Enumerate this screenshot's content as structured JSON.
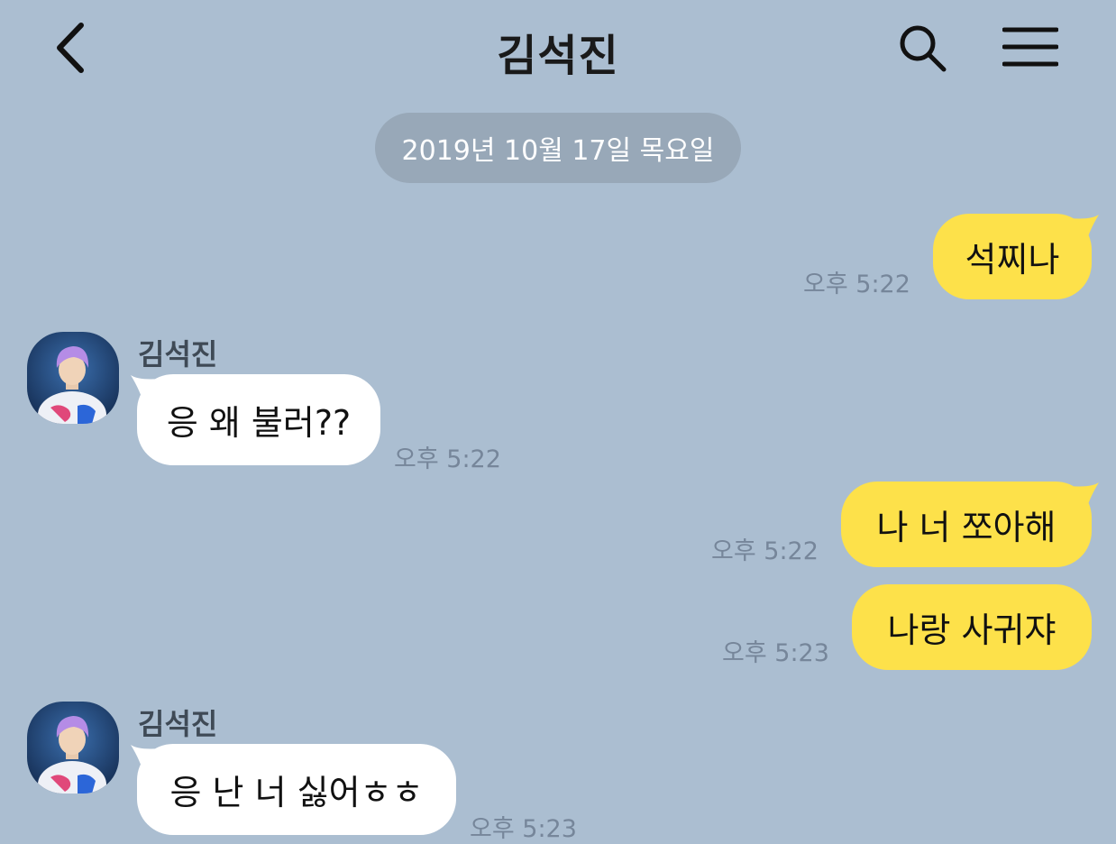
{
  "header": {
    "title": "김석진",
    "back_icon": "chevron-left-icon",
    "search_icon": "search-icon",
    "menu_icon": "hamburger-menu-icon"
  },
  "date_divider": "2019년 10월 17일 목요일",
  "colors": {
    "background": "#abbed1",
    "my_bubble": "#fde14a",
    "their_bubble": "#ffffff",
    "date_chip": "#98a8b8",
    "time_text": "#76869a"
  },
  "messages": [
    {
      "from": "me",
      "text": "석찌나",
      "time": "오후 5:22"
    },
    {
      "from": "other",
      "sender": "김석진",
      "text": "응 왜 불러??",
      "time": "오후 5:22"
    },
    {
      "from": "me",
      "text": "나 너 쪼아해",
      "time": "오후 5:22"
    },
    {
      "from": "me",
      "text": "나랑 사귀쟈",
      "time": "오후 5:23"
    },
    {
      "from": "other",
      "sender": "김석진",
      "text": "응 난 너 싫어ㅎㅎ",
      "time": "오후 5:23"
    }
  ]
}
